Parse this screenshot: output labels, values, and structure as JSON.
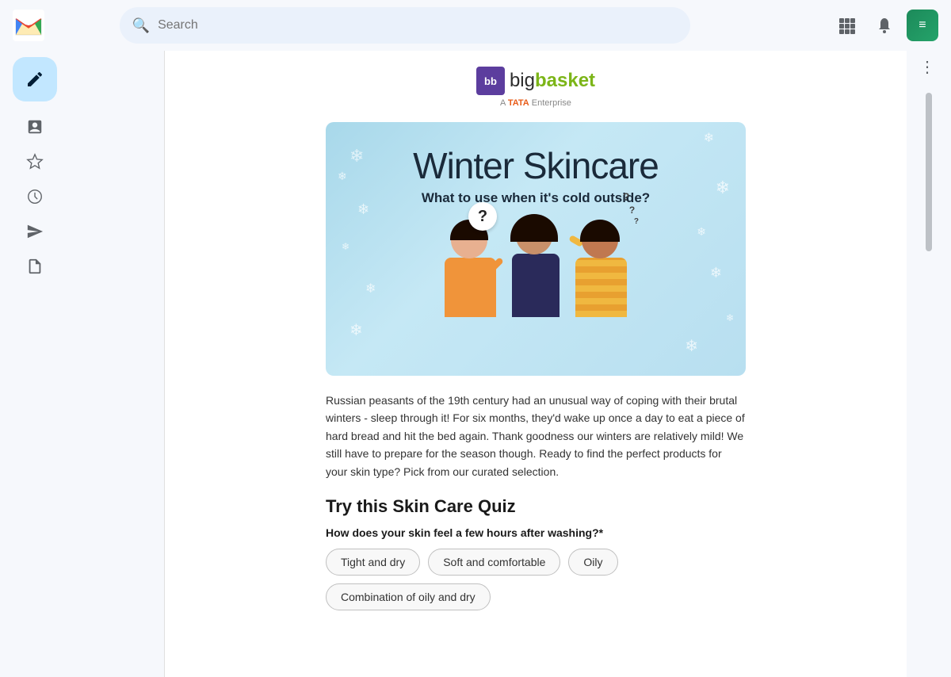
{
  "topbar": {
    "search_placeholder": "Search",
    "search_icon": "search-icon"
  },
  "gmail": {
    "logo_text": "M",
    "logo_colors": [
      "#EA4335",
      "#FBBC05",
      "#34A853",
      "#4285F4"
    ]
  },
  "sidebar": {
    "compose_icon": "+",
    "nav_items": [
      {
        "name": "inbox",
        "icon": "🖼"
      },
      {
        "name": "starred",
        "icon": "☆"
      },
      {
        "name": "snoozed",
        "icon": "🕐"
      },
      {
        "name": "sent",
        "icon": "▷"
      },
      {
        "name": "drafts",
        "icon": "📄"
      }
    ]
  },
  "email": {
    "brand": {
      "logo_bb": "bb",
      "logo_name_prefix": "big",
      "logo_name_suffix": "basket",
      "tata_text": "A TATA Enterprise"
    },
    "banner": {
      "title": "Winter Skincare",
      "subtitle": "What to use when it's cold outside?"
    },
    "body_text": "Russian peasants of the 19th century had an unusual way of coping with their brutal winters - sleep through it! For six months, they'd wake up once a day to eat a piece of hard bread and hit the bed again. Thank goodness our winters are relatively mild! We still have to prepare for the season though. Ready to find the perfect products for your skin type? Pick from our curated selection.",
    "quiz": {
      "title": "Try this Skin Care Quiz",
      "question": "How does your skin feel a few hours after washing?*",
      "options": [
        {
          "label": "Tight and dry",
          "id": "tight-dry"
        },
        {
          "label": "Soft and comfortable",
          "id": "soft-comfortable"
        },
        {
          "label": "Oily",
          "id": "oily"
        },
        {
          "label": "Combination of oily and dry",
          "id": "combination"
        }
      ]
    }
  }
}
